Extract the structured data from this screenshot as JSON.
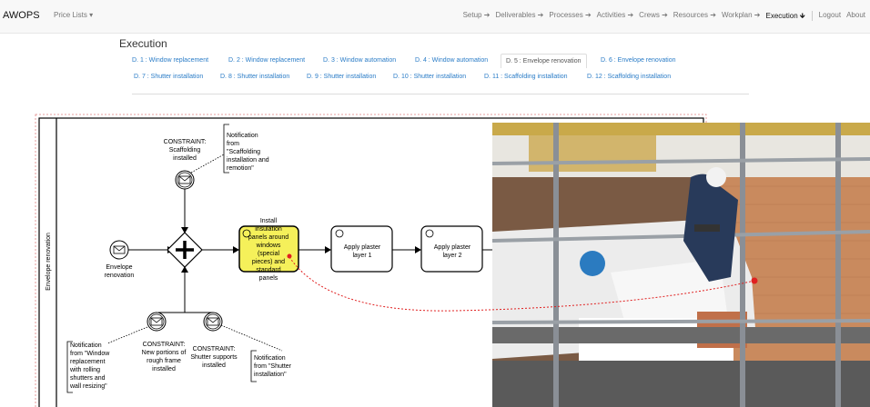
{
  "navbar": {
    "brand": "AWOPS",
    "price_lists": "Price Lists ▾",
    "items": [
      "Setup ➔",
      "Deliverables ➔",
      "Processes ➔",
      "Activities ➔",
      "Crews ➔",
      "Resources ➔",
      "Workplan ➔",
      "Execution 🡻"
    ],
    "logout": "Logout",
    "about": "About"
  },
  "page": {
    "title": "Execution"
  },
  "tabs": {
    "row1": [
      "D. 1 : Window replacement",
      "D. 2 : Window replacement",
      "D. 3 : Window automation",
      "D. 4 : Window automation",
      "D. 5 : Envelope renovation",
      "D. 6 : Envelope renovation"
    ],
    "row2": [
      "D. 7 : Shutter installation",
      "D. 8 : Shutter installation",
      "D. 9 : Shutter installation",
      "D. 10 : Shutter installation",
      "D. 11 : Scaffolding installation",
      "D. 12 : Scaffolding installation"
    ],
    "active_index": 4
  },
  "diagram": {
    "lane": "Envelope renovation",
    "start_event": "Envelope renovation",
    "constraint_top": [
      "CONSTRAINT:",
      "Scaffolding",
      "installed"
    ],
    "notif_top": [
      "Notification",
      "from",
      "\"Scaffolding",
      "installation and",
      "remotion\""
    ],
    "task_active": [
      "Install",
      "insulation",
      "panels around",
      "windows",
      "(special",
      "pieces) and",
      "standard",
      "panels"
    ],
    "task2": [
      "Apply plaster",
      "layer 1"
    ],
    "task3": [
      "Apply plaster",
      "layer 2"
    ],
    "notif_left": [
      "Notification",
      "from \"Window",
      "replacement",
      "with rolling",
      "shutters and",
      "wall resizing\""
    ],
    "constraint_b1": [
      "CONSTRAINT:",
      "New portions of",
      "rough frame",
      "installed"
    ],
    "constraint_b2": [
      "CONSTRAINT:",
      "Shutter supports",
      "installed"
    ],
    "notif_b2": [
      "Notification",
      "from \"Shutter",
      "installation\""
    ],
    "colors": {
      "active_task": "#f5f05a",
      "link": "#e02020"
    }
  }
}
